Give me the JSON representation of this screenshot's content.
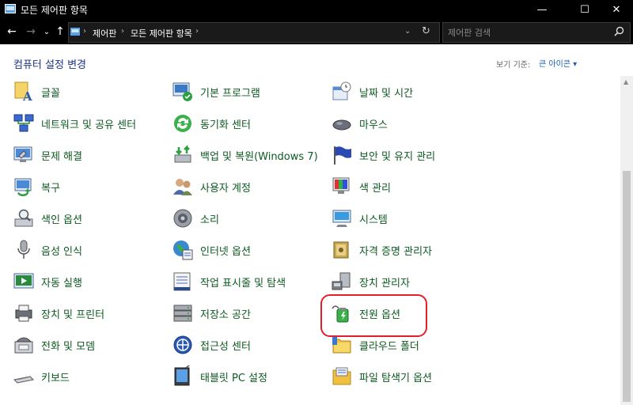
{
  "window": {
    "title": "모든 제어판 항목"
  },
  "titlebar_buttons": {
    "minimize": "—",
    "maximize": "☐",
    "close": "✕"
  },
  "nav": {
    "back": "←",
    "forward": "→",
    "recent": "⌄",
    "up": "↑"
  },
  "address": {
    "segments": [
      "제어판",
      "모든 제어판 항목"
    ],
    "separator": "›",
    "dropdown": "⌄",
    "refresh": "↻"
  },
  "search": {
    "placeholder": "제어판 검색"
  },
  "header": {
    "title": "컴퓨터 설정 변경",
    "view_by_label": "보기 기준:",
    "view_by_value": "큰 아이콘 ▾"
  },
  "items": [
    {
      "label": "글꼴",
      "icon": "fonts-icon"
    },
    {
      "label": "기본 프로그램",
      "icon": "default-programs-icon"
    },
    {
      "label": "날짜 및 시간",
      "icon": "date-time-icon"
    },
    {
      "label": "네트워크 및 공유 센터",
      "icon": "network-icon"
    },
    {
      "label": "동기화 센터",
      "icon": "sync-icon"
    },
    {
      "label": "마우스",
      "icon": "mouse-icon"
    },
    {
      "label": "문제 해결",
      "icon": "troubleshoot-icon"
    },
    {
      "label": "백업 및 복원(Windows 7)",
      "icon": "backup-icon"
    },
    {
      "label": "보안 및 유지 관리",
      "icon": "security-flag-icon"
    },
    {
      "label": "복구",
      "icon": "recovery-icon"
    },
    {
      "label": "사용자 계정",
      "icon": "user-accounts-icon"
    },
    {
      "label": "색 관리",
      "icon": "color-management-icon"
    },
    {
      "label": "색인 옵션",
      "icon": "indexing-icon"
    },
    {
      "label": "소리",
      "icon": "sound-icon"
    },
    {
      "label": "시스템",
      "icon": "system-icon"
    },
    {
      "label": "음성 인식",
      "icon": "microphone-icon"
    },
    {
      "label": "인터넷 옵션",
      "icon": "internet-options-icon"
    },
    {
      "label": "자격 증명 관리자",
      "icon": "credential-vault-icon"
    },
    {
      "label": "자동 실행",
      "icon": "autoplay-icon"
    },
    {
      "label": "작업 표시줄 및 탐색",
      "icon": "taskbar-icon"
    },
    {
      "label": "장치 관리자",
      "icon": "device-manager-icon"
    },
    {
      "label": "장치 및 프린터",
      "icon": "printer-icon"
    },
    {
      "label": "저장소 공간",
      "icon": "storage-spaces-icon"
    },
    {
      "label": "전원 옵션",
      "icon": "power-options-icon"
    },
    {
      "label": "전화 및 모뎀",
      "icon": "phone-modem-icon"
    },
    {
      "label": "접근성 센터",
      "icon": "ease-of-access-icon"
    },
    {
      "label": "클라우드 폴더",
      "icon": "cloud-folder-icon"
    },
    {
      "label": "키보드",
      "icon": "keyboard-icon"
    },
    {
      "label": "태블릿 PC 설정",
      "icon": "tablet-icon"
    },
    {
      "label": "파일 탐색기 옵션",
      "icon": "folder-options-icon"
    }
  ],
  "colors": {
    "titlebar": "#000000",
    "link_green": "#0d5a20",
    "header_blue": "#1e3287",
    "highlight_red": "#e0202a"
  }
}
